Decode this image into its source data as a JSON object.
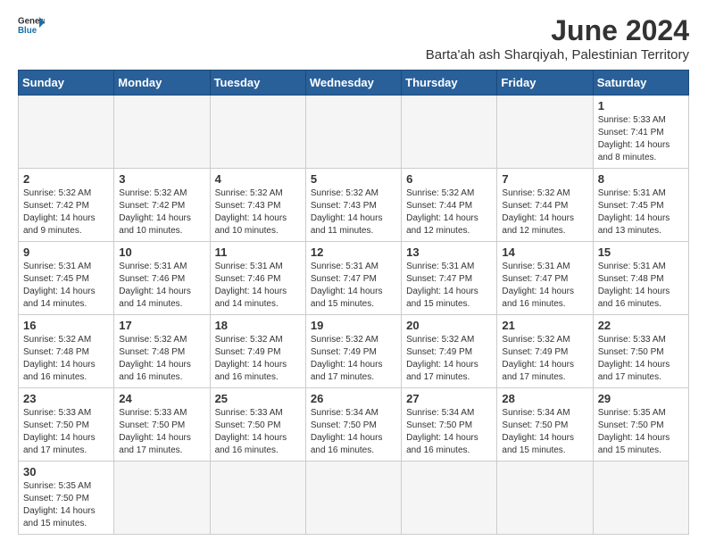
{
  "header": {
    "logo_general": "General",
    "logo_blue": "Blue",
    "main_title": "June 2024",
    "subtitle": "Barta'ah ash Sharqiyah, Palestinian Territory"
  },
  "weekdays": [
    "Sunday",
    "Monday",
    "Tuesday",
    "Wednesday",
    "Thursday",
    "Friday",
    "Saturday"
  ],
  "weeks": [
    [
      {
        "day": "",
        "info": ""
      },
      {
        "day": "",
        "info": ""
      },
      {
        "day": "",
        "info": ""
      },
      {
        "day": "",
        "info": ""
      },
      {
        "day": "",
        "info": ""
      },
      {
        "day": "",
        "info": ""
      },
      {
        "day": "1",
        "info": "Sunrise: 5:33 AM\nSunset: 7:41 PM\nDaylight: 14 hours\nand 8 minutes."
      }
    ],
    [
      {
        "day": "2",
        "info": "Sunrise: 5:32 AM\nSunset: 7:42 PM\nDaylight: 14 hours\nand 9 minutes."
      },
      {
        "day": "3",
        "info": "Sunrise: 5:32 AM\nSunset: 7:42 PM\nDaylight: 14 hours\nand 10 minutes."
      },
      {
        "day": "4",
        "info": "Sunrise: 5:32 AM\nSunset: 7:43 PM\nDaylight: 14 hours\nand 10 minutes."
      },
      {
        "day": "5",
        "info": "Sunrise: 5:32 AM\nSunset: 7:43 PM\nDaylight: 14 hours\nand 11 minutes."
      },
      {
        "day": "6",
        "info": "Sunrise: 5:32 AM\nSunset: 7:44 PM\nDaylight: 14 hours\nand 12 minutes."
      },
      {
        "day": "7",
        "info": "Sunrise: 5:32 AM\nSunset: 7:44 PM\nDaylight: 14 hours\nand 12 minutes."
      },
      {
        "day": "8",
        "info": "Sunrise: 5:31 AM\nSunset: 7:45 PM\nDaylight: 14 hours\nand 13 minutes."
      }
    ],
    [
      {
        "day": "9",
        "info": "Sunrise: 5:31 AM\nSunset: 7:45 PM\nDaylight: 14 hours\nand 14 minutes."
      },
      {
        "day": "10",
        "info": "Sunrise: 5:31 AM\nSunset: 7:46 PM\nDaylight: 14 hours\nand 14 minutes."
      },
      {
        "day": "11",
        "info": "Sunrise: 5:31 AM\nSunset: 7:46 PM\nDaylight: 14 hours\nand 14 minutes."
      },
      {
        "day": "12",
        "info": "Sunrise: 5:31 AM\nSunset: 7:47 PM\nDaylight: 14 hours\nand 15 minutes."
      },
      {
        "day": "13",
        "info": "Sunrise: 5:31 AM\nSunset: 7:47 PM\nDaylight: 14 hours\nand 15 minutes."
      },
      {
        "day": "14",
        "info": "Sunrise: 5:31 AM\nSunset: 7:47 PM\nDaylight: 14 hours\nand 16 minutes."
      },
      {
        "day": "15",
        "info": "Sunrise: 5:31 AM\nSunset: 7:48 PM\nDaylight: 14 hours\nand 16 minutes."
      }
    ],
    [
      {
        "day": "16",
        "info": "Sunrise: 5:32 AM\nSunset: 7:48 PM\nDaylight: 14 hours\nand 16 minutes."
      },
      {
        "day": "17",
        "info": "Sunrise: 5:32 AM\nSunset: 7:48 PM\nDaylight: 14 hours\nand 16 minutes."
      },
      {
        "day": "18",
        "info": "Sunrise: 5:32 AM\nSunset: 7:49 PM\nDaylight: 14 hours\nand 16 minutes."
      },
      {
        "day": "19",
        "info": "Sunrise: 5:32 AM\nSunset: 7:49 PM\nDaylight: 14 hours\nand 17 minutes."
      },
      {
        "day": "20",
        "info": "Sunrise: 5:32 AM\nSunset: 7:49 PM\nDaylight: 14 hours\nand 17 minutes."
      },
      {
        "day": "21",
        "info": "Sunrise: 5:32 AM\nSunset: 7:49 PM\nDaylight: 14 hours\nand 17 minutes."
      },
      {
        "day": "22",
        "info": "Sunrise: 5:33 AM\nSunset: 7:50 PM\nDaylight: 14 hours\nand 17 minutes."
      }
    ],
    [
      {
        "day": "23",
        "info": "Sunrise: 5:33 AM\nSunset: 7:50 PM\nDaylight: 14 hours\nand 17 minutes."
      },
      {
        "day": "24",
        "info": "Sunrise: 5:33 AM\nSunset: 7:50 PM\nDaylight: 14 hours\nand 17 minutes."
      },
      {
        "day": "25",
        "info": "Sunrise: 5:33 AM\nSunset: 7:50 PM\nDaylight: 14 hours\nand 16 minutes."
      },
      {
        "day": "26",
        "info": "Sunrise: 5:34 AM\nSunset: 7:50 PM\nDaylight: 14 hours\nand 16 minutes."
      },
      {
        "day": "27",
        "info": "Sunrise: 5:34 AM\nSunset: 7:50 PM\nDaylight: 14 hours\nand 16 minutes."
      },
      {
        "day": "28",
        "info": "Sunrise: 5:34 AM\nSunset: 7:50 PM\nDaylight: 14 hours\nand 15 minutes."
      },
      {
        "day": "29",
        "info": "Sunrise: 5:35 AM\nSunset: 7:50 PM\nDaylight: 14 hours\nand 15 minutes."
      }
    ],
    [
      {
        "day": "30",
        "info": "Sunrise: 5:35 AM\nSunset: 7:50 PM\nDaylight: 14 hours\nand 15 minutes."
      },
      {
        "day": "",
        "info": ""
      },
      {
        "day": "",
        "info": ""
      },
      {
        "day": "",
        "info": ""
      },
      {
        "day": "",
        "info": ""
      },
      {
        "day": "",
        "info": ""
      },
      {
        "day": "",
        "info": ""
      }
    ]
  ]
}
